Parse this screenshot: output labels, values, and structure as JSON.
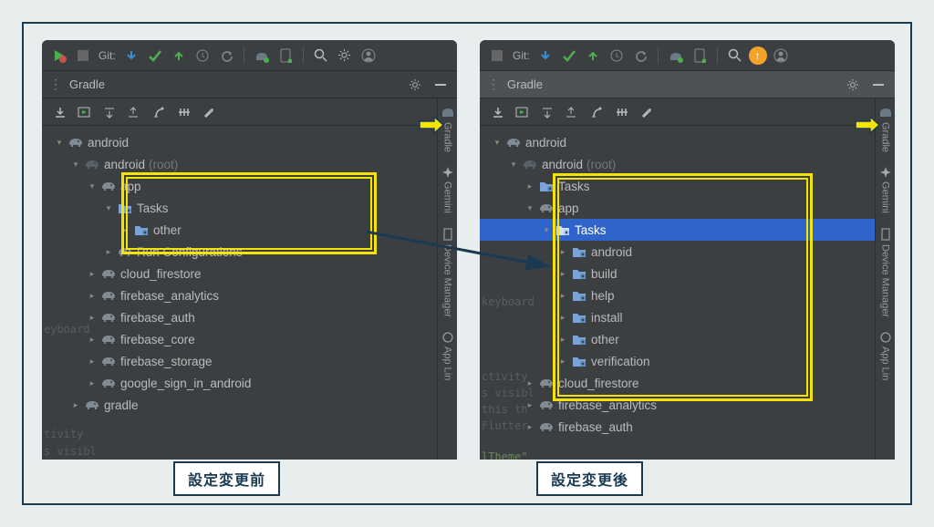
{
  "captions": {
    "before": "設定変更前",
    "after": "設定変更後"
  },
  "git_label": "Git:",
  "panel_title": "Gradle",
  "side_tabs": [
    "Gradle",
    "Gemini",
    "Device Manager",
    "App Lin"
  ],
  "bg_left": {
    "kb": "eyboard",
    "act": "tivity",
    "vis": "s visibl"
  },
  "bg_right": {
    "kb": "keyboard",
    "act": "ctivity",
    "vis": "s visibl",
    "thi": "this th",
    "flu": "Flutter",
    "thm": "lTheme\""
  },
  "left_tree": [
    {
      "ind": 0,
      "arrow": "down",
      "icon": "elephant",
      "label": "android"
    },
    {
      "ind": 1,
      "arrow": "down",
      "icon": "elephant",
      "label": "android",
      "dim": "(root)",
      "faded": true
    },
    {
      "ind": 2,
      "arrow": "down",
      "icon": "elephant",
      "label": "app"
    },
    {
      "ind": 3,
      "arrow": "down",
      "icon": "folder",
      "label": "Tasks"
    },
    {
      "ind": 4,
      "arrow": "right",
      "icon": "folder",
      "label": "other"
    },
    {
      "ind": 3,
      "arrow": "right",
      "icon": "elephant",
      "label": "Run Configurations"
    },
    {
      "ind": 2,
      "arrow": "right",
      "icon": "elephant",
      "label": "cloud_firestore"
    },
    {
      "ind": 2,
      "arrow": "right",
      "icon": "elephant",
      "label": "firebase_analytics"
    },
    {
      "ind": 2,
      "arrow": "right",
      "icon": "elephant",
      "label": "firebase_auth"
    },
    {
      "ind": 2,
      "arrow": "right",
      "icon": "elephant",
      "label": "firebase_core"
    },
    {
      "ind": 2,
      "arrow": "right",
      "icon": "elephant",
      "label": "firebase_storage"
    },
    {
      "ind": 2,
      "arrow": "right",
      "icon": "elephant",
      "label": "google_sign_in_android"
    },
    {
      "ind": 1,
      "arrow": "right",
      "icon": "elephant",
      "label": "gradle"
    }
  ],
  "right_tree": [
    {
      "ind": 0,
      "arrow": "down",
      "icon": "elephant",
      "label": "android"
    },
    {
      "ind": 1,
      "arrow": "down",
      "icon": "elephant",
      "label": "android",
      "dim": "(root)",
      "faded": true
    },
    {
      "ind": 2,
      "arrow": "right",
      "icon": "folder",
      "label": "Tasks"
    },
    {
      "ind": 2,
      "arrow": "down",
      "icon": "elephant",
      "label": "app"
    },
    {
      "ind": 3,
      "arrow": "down",
      "icon": "folder",
      "label": "Tasks",
      "selected": true
    },
    {
      "ind": 4,
      "arrow": "right",
      "icon": "folder",
      "label": "android"
    },
    {
      "ind": 4,
      "arrow": "right",
      "icon": "folder",
      "label": "build"
    },
    {
      "ind": 4,
      "arrow": "right",
      "icon": "folder",
      "label": "help"
    },
    {
      "ind": 4,
      "arrow": "right",
      "icon": "folder",
      "label": "install"
    },
    {
      "ind": 4,
      "arrow": "right",
      "icon": "folder",
      "label": "other"
    },
    {
      "ind": 4,
      "arrow": "right",
      "icon": "folder",
      "label": "verification"
    },
    {
      "ind": 2,
      "arrow": "right",
      "icon": "elephant",
      "label": "cloud_firestore"
    },
    {
      "ind": 2,
      "arrow": "right",
      "icon": "elephant",
      "label": "firebase_analytics"
    },
    {
      "ind": 2,
      "arrow": "right",
      "icon": "elephant",
      "label": "firebase_auth",
      "cut": true
    }
  ]
}
